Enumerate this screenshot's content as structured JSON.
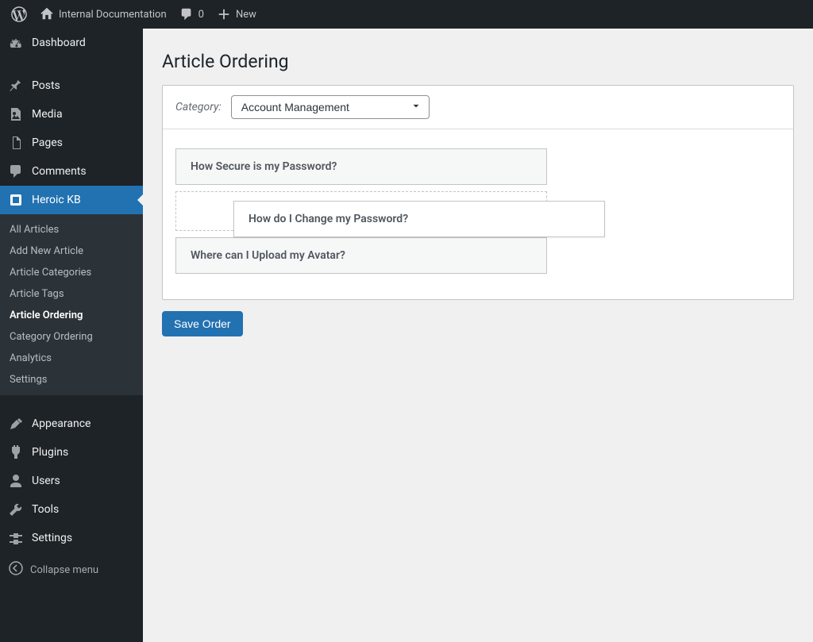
{
  "adminbar": {
    "site_title": "Internal Documentation",
    "comments_count": "0",
    "new_label": "New"
  },
  "sidebar": {
    "dashboard": "Dashboard",
    "posts": "Posts",
    "media": "Media",
    "pages": "Pages",
    "comments": "Comments",
    "heroic_kb": "Heroic KB",
    "submenu": {
      "all_articles": "All Articles",
      "add_new": "Add New Article",
      "categories": "Article Categories",
      "tags": "Article Tags",
      "article_ordering": "Article Ordering",
      "category_ordering": "Category Ordering",
      "analytics": "Analytics",
      "settings": "Settings"
    },
    "appearance": "Appearance",
    "plugins": "Plugins",
    "users": "Users",
    "tools": "Tools",
    "settings": "Settings",
    "collapse": "Collapse menu"
  },
  "main": {
    "title": "Article Ordering",
    "category_label": "Category:",
    "category_selected": "Account Management",
    "articles": [
      "How Secure is my Password?",
      "How do I Change my Password?",
      "Where can I Upload my Avatar?"
    ],
    "save_label": "Save Order"
  }
}
